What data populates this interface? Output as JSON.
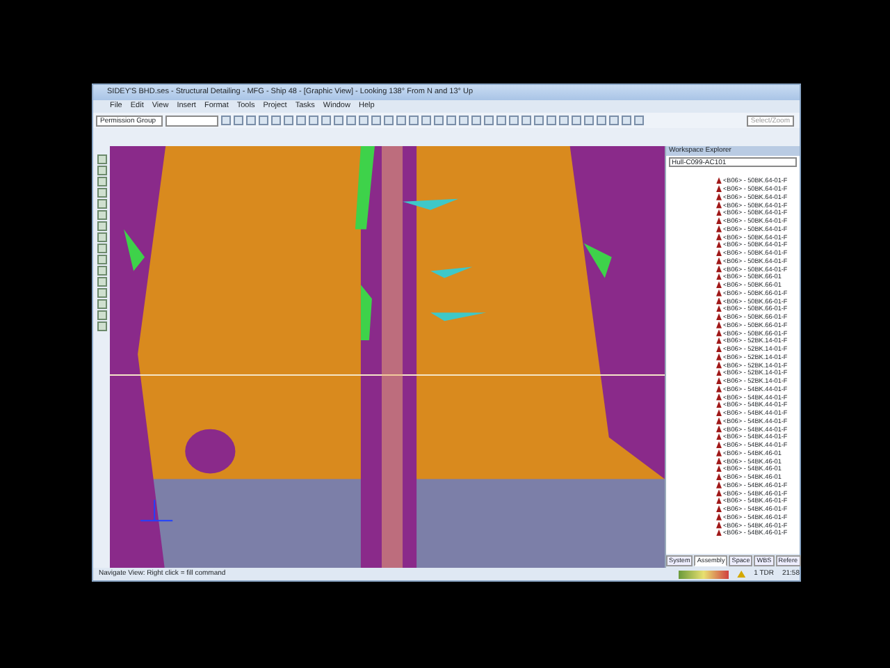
{
  "window": {
    "title": "SIDEY'S BHD.ses - Structural Detailing - MFG - Ship 48 - [Graphic View] - Looking 138° From N and 13° Up"
  },
  "menu": [
    "File",
    "Edit",
    "View",
    "Insert",
    "Format",
    "Tools",
    "Project",
    "Tasks",
    "Window",
    "Help"
  ],
  "toolbar": {
    "group_dropdown": "Permission Group",
    "mode_field": "Select/Zoom"
  },
  "explorer": {
    "title": "Workspace Explorer",
    "filter": "Hull-C099-AC101",
    "items": [
      "<B06> - 50BK.64-01-F",
      "<B06> - 50BK.64-01-F",
      "<B06> - 50BK.64-01-F",
      "<B06> - 50BK.64-01-F",
      "<B06> - 50BK.64-01-F",
      "<B06> - 50BK.64-01-F",
      "<B06> - 50BK.64-01-F",
      "<B06> - 50BK.64-01-F",
      "<B06> - 50BK.64-01-F",
      "<B06> - 50BK.64-01-F",
      "<B06> - 50BK.64-01-F",
      "<B06> - 50BK.64-01-F",
      "<B06> - 50BK.66-01",
      "<B06> - 50BK.66-01",
      "<B06> - 50BK.66-01-F",
      "<B06> - 50BK.66-01-F",
      "<B06> - 50BK.66-01-F",
      "<B06> - 50BK.66-01-F",
      "<B06> - 50BK.66-01-F",
      "<B06> - 50BK.66-01-F",
      "<B06> - 52BK.14-01-F",
      "<B06> - 52BK.14-01-F",
      "<B06> - 52BK.14-01-F",
      "<B06> - 52BK.14-01-F",
      "<B06> - 52BK.14-01-F",
      "<B06> - 52BK.14-01-F",
      "<B06> - 54BK.44-01-F",
      "<B06> - 54BK.44-01-F",
      "<B06> - 54BK.44-01-F",
      "<B06> - 54BK.44-01-F",
      "<B06> - 54BK.44-01-F",
      "<B06> - 54BK.44-01-F",
      "<B06> - 54BK.44-01-F",
      "<B06> - 54BK.44-01-F",
      "<B06> - 54BK.46-01",
      "<B06> - 54BK.46-01",
      "<B06> - 54BK.46-01",
      "<B06> - 54BK.46-01",
      "<B06> - 54BK.46-01-F",
      "<B06> - 54BK.46-01-F",
      "<B06> - 54BK.46-01-F",
      "<B06> - 54BK.46-01-F",
      "<B06> - 54BK.46-01-F",
      "<B06> - 54BK.46-01-F",
      "<B06> - 54BK.46-01-F"
    ],
    "tabs": [
      {
        "label": "System",
        "selected": false
      },
      {
        "label": "Assembly",
        "selected": true
      },
      {
        "label": "Space",
        "selected": false
      },
      {
        "label": "WBS",
        "selected": false
      },
      {
        "label": "Refere",
        "selected": false
      }
    ]
  },
  "status_bar": {
    "hint": "Navigate View: Right click = fill command",
    "alert": "1 TDR",
    "time": "21:58"
  }
}
